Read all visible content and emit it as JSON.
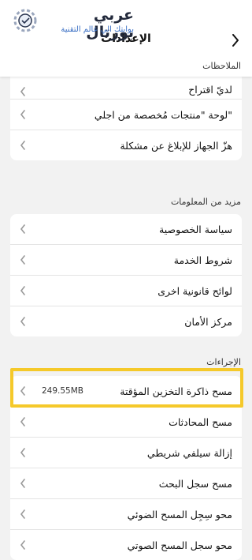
{
  "watermark": {
    "brand": "عربي بورتال",
    "tagline": "بوابتك الي عالم التقنية"
  },
  "header": {
    "title": "الإعدادات"
  },
  "sections": {
    "notes": {
      "label": "الملاحظات",
      "items": [
        {
          "label": "لديّ اقتراح"
        },
        {
          "label": "لوحة \"منتجات مُخصصة من اجلي\""
        },
        {
          "label": "هزّ الجهاز للإبلاغ عن مشكلة"
        }
      ]
    },
    "more_info": {
      "label": "مزيد من المعلومات",
      "items": [
        {
          "label": "سياسة الخصوصية"
        },
        {
          "label": "شروط الخدمة"
        },
        {
          "label": "لوائح قانونية اخرى"
        },
        {
          "label": "مركز الأمان"
        }
      ]
    },
    "actions": {
      "label": "الإجراءات",
      "items": [
        {
          "label": "مسح ذاكرة التخزين المؤقتة",
          "value": "249.55MB"
        },
        {
          "label": "مسح المحادثات"
        },
        {
          "label": "إزالة سيلفي شريطي"
        },
        {
          "label": "مسح سجل البحث"
        },
        {
          "label": "محو سِجِل المسح الضوئي"
        },
        {
          "label": "محو سجل المسح الصوتي"
        }
      ]
    }
  },
  "colors": {
    "highlight": "#f5c92a",
    "background": "#f2f2f2"
  }
}
